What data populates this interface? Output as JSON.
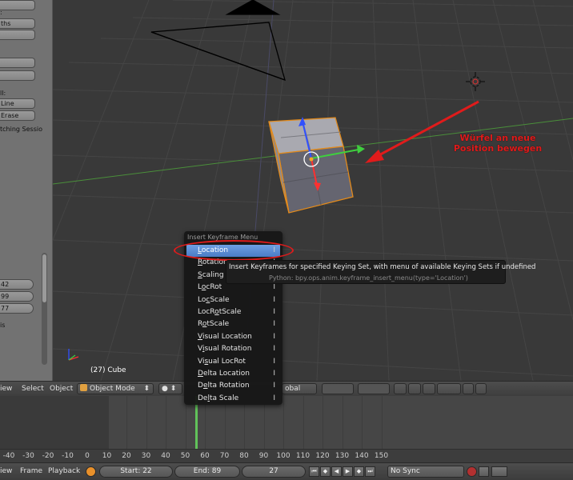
{
  "toolshelf": {
    "frag1": ":",
    "btn_paths": "ths",
    "label_ll": "ll:",
    "btn_line": "Line",
    "btn_erase": "Erase",
    "label_sketch": "tching Sessio",
    "num1": "42",
    "num2": "99",
    "num3": "77",
    "label_is": "is"
  },
  "viewport": {
    "object_label": "(27) Cube",
    "annotation_line1": "Würfel an neue",
    "annotation_line2": "Position bewegen"
  },
  "header3d": {
    "view": "iew",
    "select": "Select",
    "object": "Object",
    "mode": "Object Mode",
    "orientation": "obal"
  },
  "insert_menu": {
    "title": "Insert Keyframe Menu",
    "items": [
      {
        "pre": "",
        "u": "L",
        "post": "ocation",
        "shortcut": "I"
      },
      {
        "pre": "",
        "u": "R",
        "post": "otation",
        "shortcut": "I"
      },
      {
        "pre": "",
        "u": "S",
        "post": "caling",
        "shortcut": "I"
      },
      {
        "pre": "L",
        "u": "o",
        "post": "cRot",
        "shortcut": "I"
      },
      {
        "pre": "Lo",
        "u": "c",
        "post": "Scale",
        "shortcut": "I"
      },
      {
        "pre": "LocR",
        "u": "o",
        "post": "tScale",
        "shortcut": "I"
      },
      {
        "pre": "R",
        "u": "o",
        "post": "tScale",
        "shortcut": "I"
      },
      {
        "pre": "",
        "u": "V",
        "post": "isual Location",
        "shortcut": "I"
      },
      {
        "pre": "V",
        "u": "i",
        "post": "sual Rotation",
        "shortcut": "I"
      },
      {
        "pre": "Vi",
        "u": "s",
        "post": "ual LocRot",
        "shortcut": "I"
      },
      {
        "pre": "",
        "u": "D",
        "post": "elta Location",
        "shortcut": "I"
      },
      {
        "pre": "D",
        "u": "e",
        "post": "lta Rotation",
        "shortcut": "I"
      },
      {
        "pre": "De",
        "u": "l",
        "post": "ta Scale",
        "shortcut": "I"
      }
    ]
  },
  "tooltip": {
    "text": "Insert Keyframes for specified Keying Set, with menu of available Keying Sets if undefined",
    "python": "Python: bpy.ops.anim.keyframe_insert_menu(type='Location')"
  },
  "timeline": {
    "ticks": [
      "-40",
      "-30",
      "-20",
      "-10",
      "0",
      "10",
      "20",
      "30",
      "40",
      "50",
      "60",
      "70",
      "80",
      "90",
      "100",
      "110",
      "120",
      "130",
      "140",
      "150"
    ]
  },
  "footer": {
    "view": "iew",
    "frame": "Frame",
    "playback": "Playback",
    "start": "Start: 22",
    "end": "End: 89",
    "current": "27",
    "sync": "No Sync"
  },
  "colors": {
    "accent_red": "#e01b1b",
    "menu_highlight": "#5a8bd6",
    "playhead": "#61c25a"
  }
}
